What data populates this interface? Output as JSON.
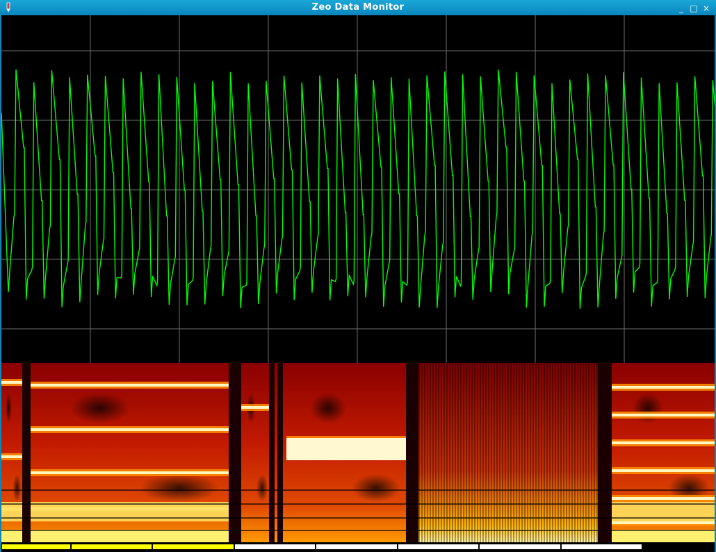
{
  "window": {
    "title": "Zeo Data Monitor",
    "buttons": {
      "minimize": "_",
      "maximize": "□",
      "close": "×"
    }
  },
  "colors": {
    "titlebar": "#0a86bd",
    "trace": "#00ff00",
    "grid": "#6e6e6e",
    "background": "#000000",
    "sleep_stage_yellow": "#ffff00",
    "sleep_stage_white": "#ffffff"
  },
  "icons": {
    "app": "pen-icon",
    "minimize": "minimize-icon",
    "maximize": "maximize-icon",
    "close": "close-icon"
  },
  "hypnogram": {
    "segments": [
      "yellow",
      "yellow",
      "yellow",
      "white",
      "white",
      "white",
      "white",
      "white",
      "black"
    ]
  }
}
